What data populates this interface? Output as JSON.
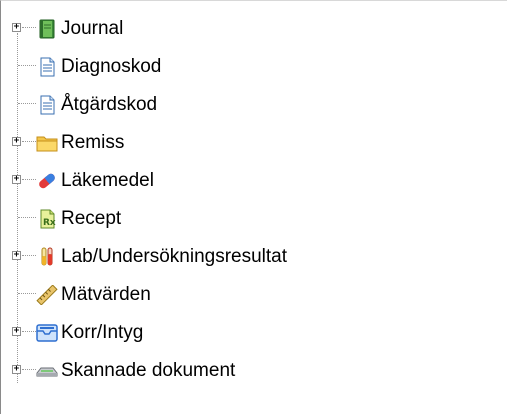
{
  "tree": {
    "items": [
      {
        "label": "Journal",
        "icon": "journal-book-icon",
        "expandable": true,
        "expander": "+"
      },
      {
        "label": "Diagnoskod",
        "icon": "document-icon",
        "expandable": false
      },
      {
        "label": "Åtgärdskod",
        "icon": "document-icon",
        "expandable": false
      },
      {
        "label": "Remiss",
        "icon": "folder-icon",
        "expandable": true,
        "expander": "+"
      },
      {
        "label": "Läkemedel",
        "icon": "pill-capsule-icon",
        "expandable": true,
        "expander": "+"
      },
      {
        "label": "Recept",
        "icon": "prescription-icon",
        "expandable": false
      },
      {
        "label": "Lab/Undersökningsresultat",
        "icon": "test-tubes-icon",
        "expandable": true,
        "expander": "+"
      },
      {
        "label": "Mätvärden",
        "icon": "ruler-icon",
        "expandable": false
      },
      {
        "label": "Korr/Intyg",
        "icon": "mail-tray-icon",
        "expandable": true,
        "expander": "+"
      },
      {
        "label": "Skannade dokument",
        "icon": "scanner-icon",
        "expandable": true,
        "expander": "+"
      }
    ]
  }
}
